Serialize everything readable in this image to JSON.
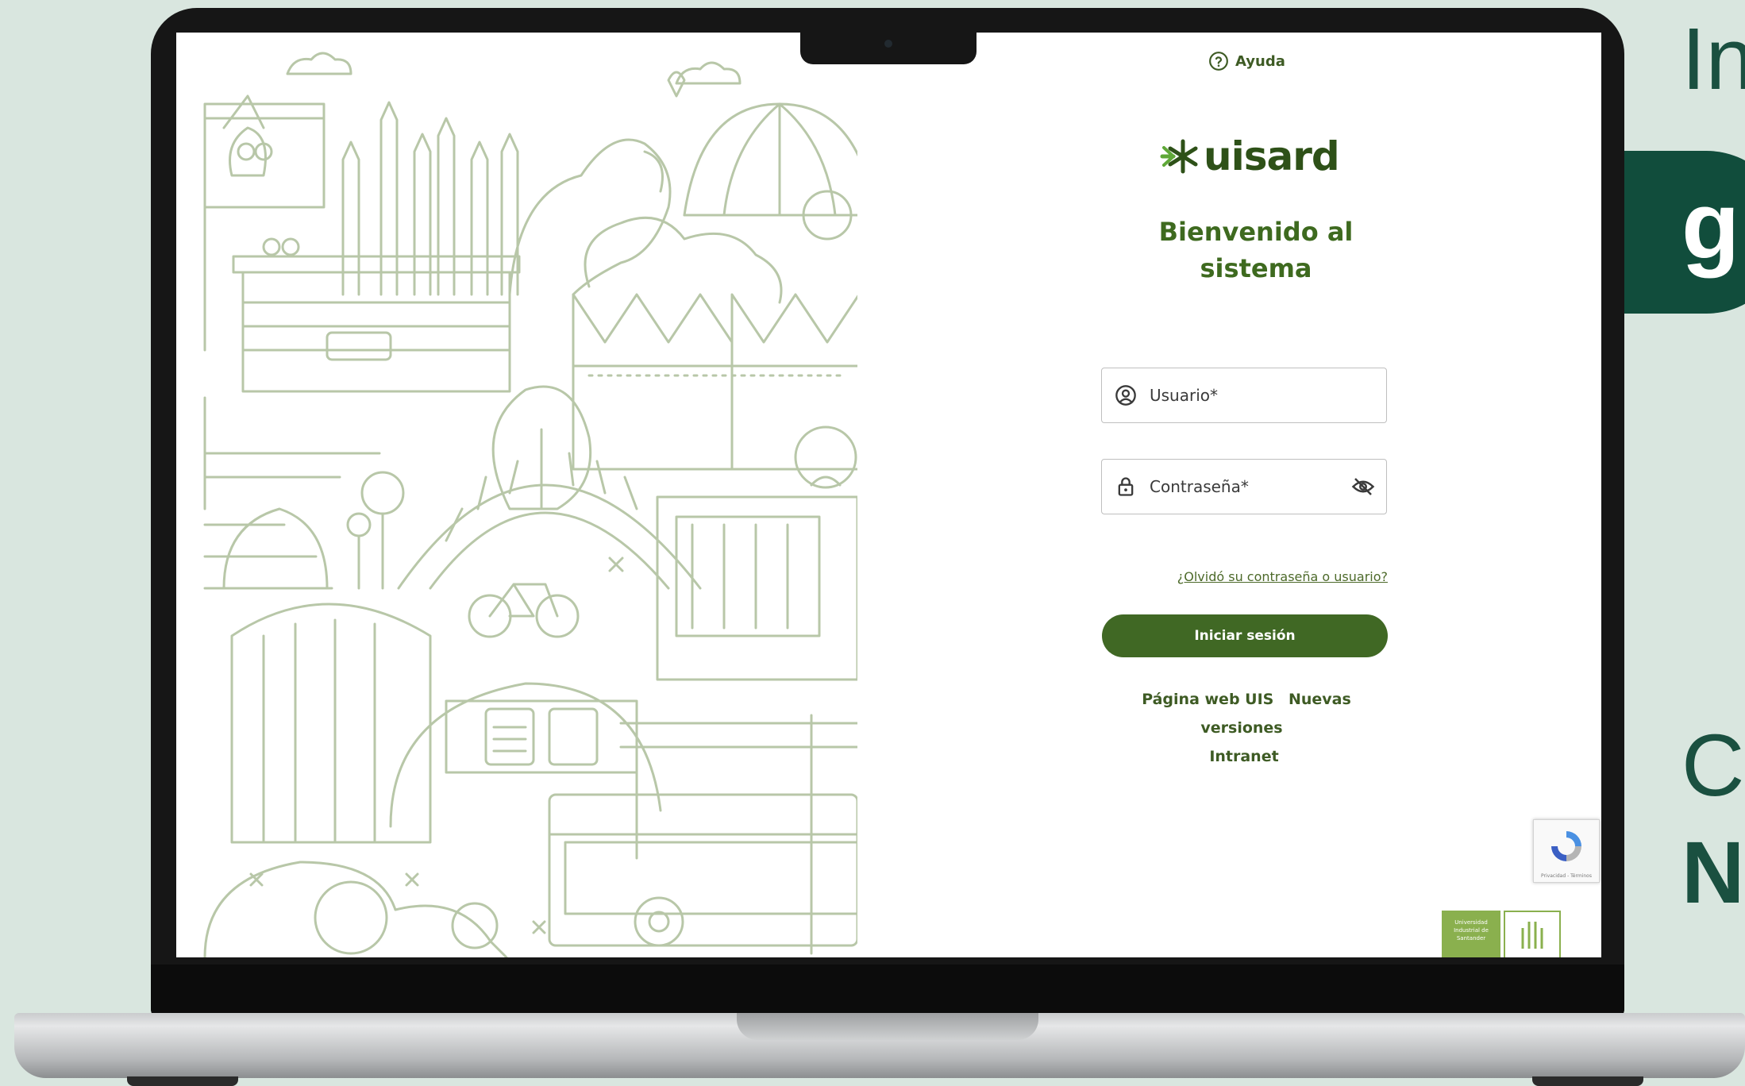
{
  "help": {
    "label": "Ayuda",
    "icon": "help-circle-icon"
  },
  "brand": {
    "logo_text": "uisard",
    "logo_icon": "asterisk-arrow-icon",
    "color": "#2e5118"
  },
  "login": {
    "welcome": "Bienvenido al sistema",
    "username": {
      "placeholder": "Usuario*",
      "value": "",
      "icon": "user-circle-icon"
    },
    "password": {
      "placeholder": "Contraseña*",
      "value": "",
      "icon": "lock-icon",
      "toggle_icon": "eye-off-icon"
    },
    "forgot_link": "¿Olvidó su contraseña o usuario?",
    "submit_label": "Iniciar sesión",
    "button_color": "#406824"
  },
  "footer_links": [
    {
      "label": "Página web UIS"
    },
    {
      "label": "Nuevas versiones"
    },
    {
      "label": "Intranet"
    }
  ],
  "recaptcha": {
    "label": "Privacidad - Términos"
  },
  "institution": {
    "name": "Universidad Industrial de Santander",
    "abbr": "UIS"
  },
  "promo": {
    "line1": "In",
    "pill": "g",
    "line3": "C",
    "line4": "N"
  },
  "colors": {
    "background": "#d9e6df",
    "promo_dark": "#114d3c",
    "illustration_stroke": "#b8c7a8"
  }
}
